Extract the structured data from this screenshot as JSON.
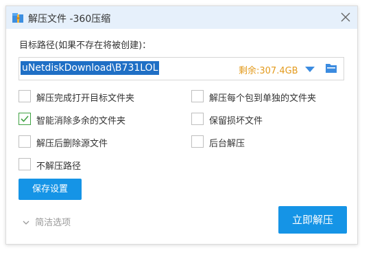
{
  "window": {
    "title": "解压文件 -360压缩",
    "app_icon": "360-zip-icon",
    "close_icon": "close-icon"
  },
  "path": {
    "label": "目标路径(如果不存在将被创建)：",
    "value": "uNetdiskDownload\\B731LOL",
    "free_space": "剩余:307.4GB",
    "dropdown_icon": "chevron-down-icon",
    "browse_icon": "folder-icon"
  },
  "options": [
    {
      "label": "解压完成打开目标文件夹",
      "checked": false
    },
    {
      "label": "解压每个包到单独的文件夹",
      "checked": false
    },
    {
      "label": "智能消除多余的文件夹",
      "checked": true
    },
    {
      "label": "保留损坏文件",
      "checked": false
    },
    {
      "label": "解压后删除源文件",
      "checked": false
    },
    {
      "label": "后台解压",
      "checked": false
    },
    {
      "label": "不解压路径",
      "checked": false
    }
  ],
  "buttons": {
    "save": "保存设置",
    "simple_options": "简洁选项",
    "extract_now": "立即解压"
  },
  "colors": {
    "accent": "#1594e6",
    "titlebar": "#e6f0fb",
    "free_space": "#e39a1c",
    "check": "#3fa142",
    "selection": "#1f6fc5"
  }
}
